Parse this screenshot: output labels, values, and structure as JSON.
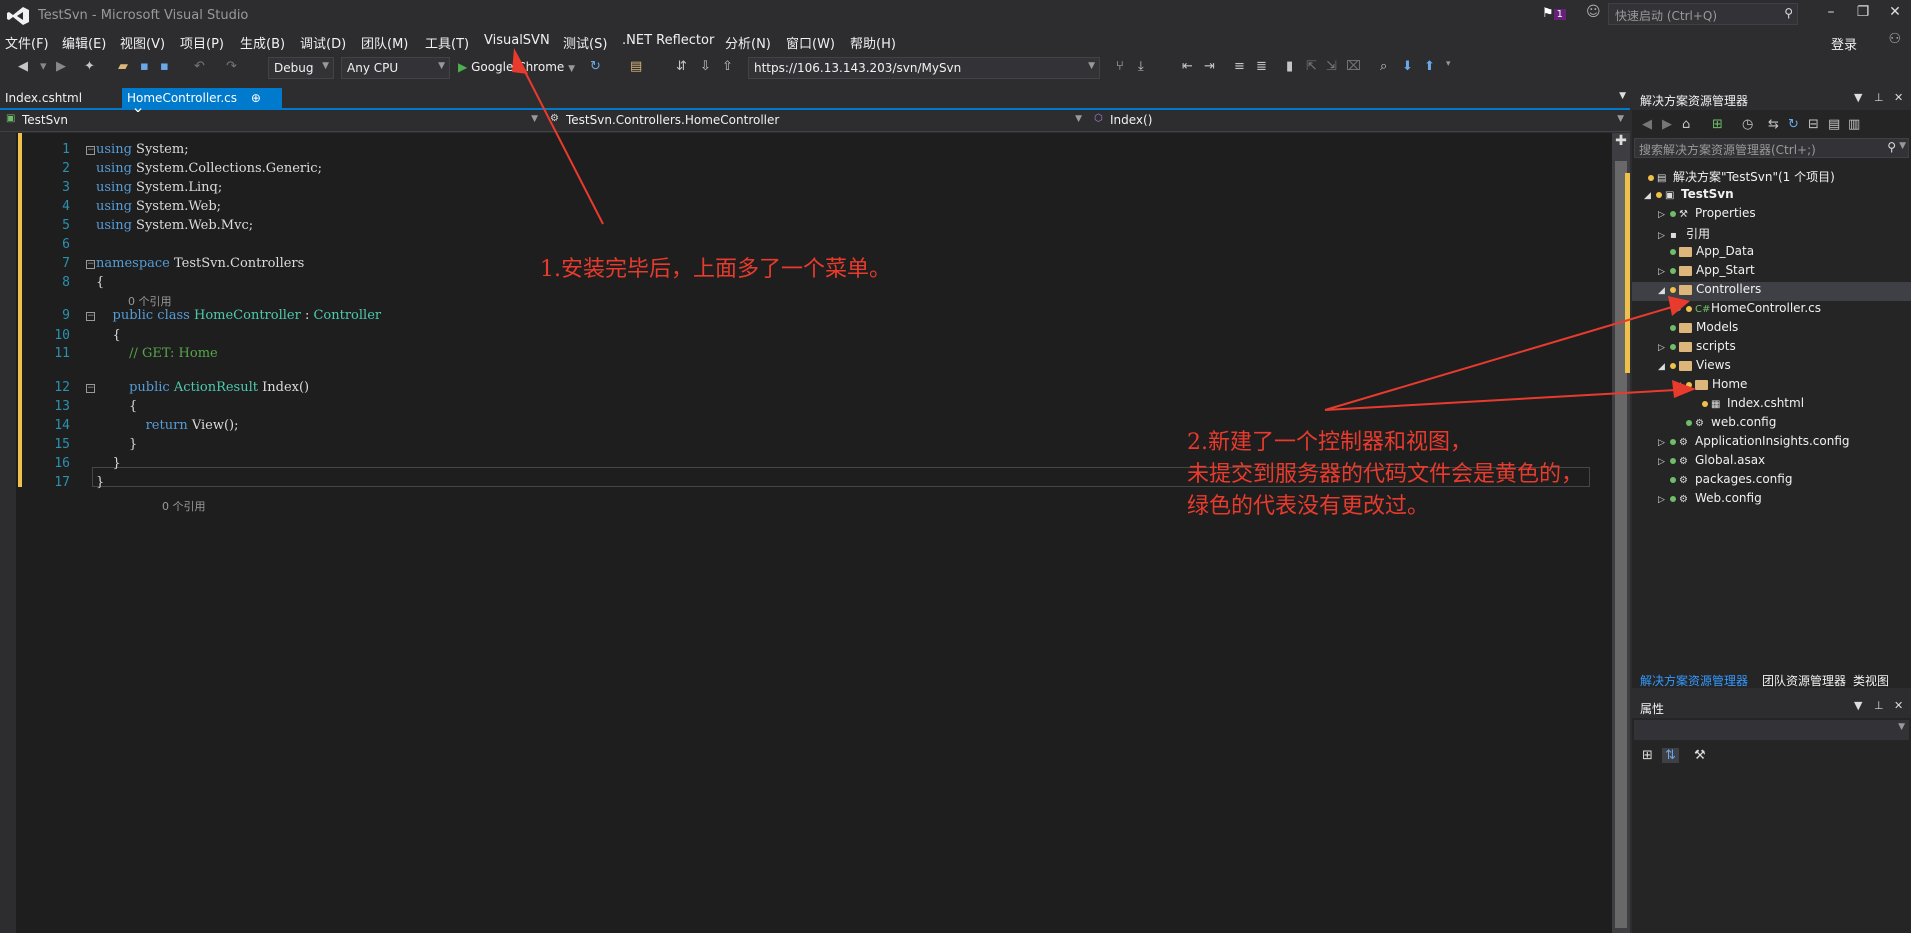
{
  "window": {
    "title": "TestSvn - Microsoft Visual Studio",
    "notification_count": "1",
    "quick_launch_placeholder": "快速启动 (Ctrl+Q)",
    "login": "登录"
  },
  "menu": [
    "文件(F)",
    "编辑(E)",
    "视图(V)",
    "项目(P)",
    "生成(B)",
    "调试(D)",
    "团队(M)",
    "工具(T)",
    "VisualSVN",
    "测试(S)",
    ".NET Reflector",
    "分析(N)",
    "窗口(W)",
    "帮助(H)"
  ],
  "toolbar": {
    "config": "Debug",
    "platform": "Any CPU",
    "run_target": "Google Chrome",
    "svn_url": "https://106.13.143.203/svn/MySvn"
  },
  "doc_tabs": [
    {
      "label": "Index.cshtml"
    },
    {
      "label": "HomeController.cs",
      "pin": "⊕",
      "close": "✕"
    }
  ],
  "navbar": {
    "project": "TestSvn",
    "class": "TestSvn.Controllers.HomeController",
    "member": "Index()"
  },
  "code": {
    "lines": [
      {
        "no": "1",
        "parts": [
          [
            "kw",
            "using"
          ],
          [
            "",
            " System;"
          ]
        ]
      },
      {
        "no": "2",
        "parts": [
          [
            "kw",
            "using"
          ],
          [
            "",
            " System.Collections.Generic;"
          ]
        ]
      },
      {
        "no": "3",
        "parts": [
          [
            "kw",
            "using"
          ],
          [
            "",
            " System.Linq;"
          ]
        ]
      },
      {
        "no": "4",
        "parts": [
          [
            "kw",
            "using"
          ],
          [
            "",
            " System.Web;"
          ]
        ]
      },
      {
        "no": "5",
        "parts": [
          [
            "kw",
            "using"
          ],
          [
            "",
            " System.Web.Mvc;"
          ]
        ]
      },
      {
        "no": "6",
        "parts": []
      },
      {
        "no": "7",
        "parts": [
          [
            "kw",
            "namespace"
          ],
          [
            "",
            " TestSvn.Controllers"
          ]
        ]
      },
      {
        "no": "8",
        "parts": [
          [
            "",
            "{"
          ]
        ]
      },
      {
        "no": "9",
        "parts": [
          [
            "",
            "    "
          ],
          [
            "kw",
            "public"
          ],
          [
            "",
            " "
          ],
          [
            "kw",
            "class"
          ],
          [
            "",
            " "
          ],
          [
            "type",
            "HomeController"
          ],
          [
            "",
            " : "
          ],
          [
            "type",
            "Controller"
          ]
        ]
      },
      {
        "no": "10",
        "parts": [
          [
            "",
            "    {"
          ]
        ]
      },
      {
        "no": "11",
        "parts": [
          [
            "",
            "        "
          ],
          [
            "cmt",
            "// GET: Home"
          ]
        ]
      },
      {
        "no": "12",
        "parts": [
          [
            "",
            "        "
          ],
          [
            "kw",
            "public"
          ],
          [
            "",
            " "
          ],
          [
            "type",
            "ActionResult"
          ],
          [
            "",
            " Index()"
          ]
        ]
      },
      {
        "no": "13",
        "parts": [
          [
            "",
            "        {"
          ]
        ]
      },
      {
        "no": "14",
        "parts": [
          [
            "",
            "            "
          ],
          [
            "kw",
            "return"
          ],
          [
            "",
            " View();"
          ]
        ]
      },
      {
        "no": "15",
        "parts": [
          [
            "",
            "        }"
          ]
        ]
      },
      {
        "no": "16",
        "parts": [
          [
            "",
            "    }"
          ]
        ]
      },
      {
        "no": "17",
        "parts": [
          [
            "",
            "}"
          ]
        ]
      }
    ],
    "codelens": "0 个引用"
  },
  "solution_explorer": {
    "title": "解决方案资源管理器",
    "search_placeholder": "搜索解决方案资源管理器(Ctrl+;)",
    "tree": [
      {
        "label": "解决方案\"TestSvn\"(1 个项目)",
        "kind": "solution",
        "status": "yellow"
      },
      {
        "label": "TestSvn",
        "kind": "project",
        "status": "yellow",
        "expanded": true
      },
      {
        "label": "Properties",
        "kind": "wrench",
        "status": "green"
      },
      {
        "label": "引用",
        "kind": "refs",
        "status": ""
      },
      {
        "label": "App_Data",
        "kind": "folder",
        "status": "green"
      },
      {
        "label": "App_Start",
        "kind": "folder",
        "status": "green"
      },
      {
        "label": "Controllers",
        "kind": "folder",
        "status": "yellow",
        "expanded": true
      },
      {
        "label": "HomeController.cs",
        "kind": "cs",
        "status": "yellow"
      },
      {
        "label": "Models",
        "kind": "folder",
        "status": "green"
      },
      {
        "label": "scripts",
        "kind": "folder",
        "status": "green"
      },
      {
        "label": "Views",
        "kind": "folder",
        "status": "yellow",
        "expanded": true
      },
      {
        "label": "Home",
        "kind": "folder",
        "status": "yellow",
        "expanded": true
      },
      {
        "label": "Index.cshtml",
        "kind": "cshtml",
        "status": "yellow"
      },
      {
        "label": "web.config",
        "kind": "config",
        "status": "green"
      },
      {
        "label": "ApplicationInsights.config",
        "kind": "config",
        "status": "green"
      },
      {
        "label": "Global.asax",
        "kind": "config",
        "status": "green"
      },
      {
        "label": "packages.config",
        "kind": "config",
        "status": "green"
      },
      {
        "label": "Web.config",
        "kind": "config",
        "status": "green"
      }
    ],
    "tabs": [
      "解决方案资源管理器",
      "团队资源管理器",
      "类视图"
    ]
  },
  "properties": {
    "title": "属性"
  },
  "annotations": {
    "note1": "1.安装完毕后，上面多了一个菜单。",
    "note2": [
      "2.新建了一个控制器和视图，",
      "未提交到服务器的代码文件会是黄色的，",
      "绿色的代表没有更改过。"
    ]
  },
  "colors": {
    "accent": "#007acc",
    "modified": "#efc14a",
    "unchanged": "#6fbd6a",
    "annotation": "#e83b2d"
  }
}
